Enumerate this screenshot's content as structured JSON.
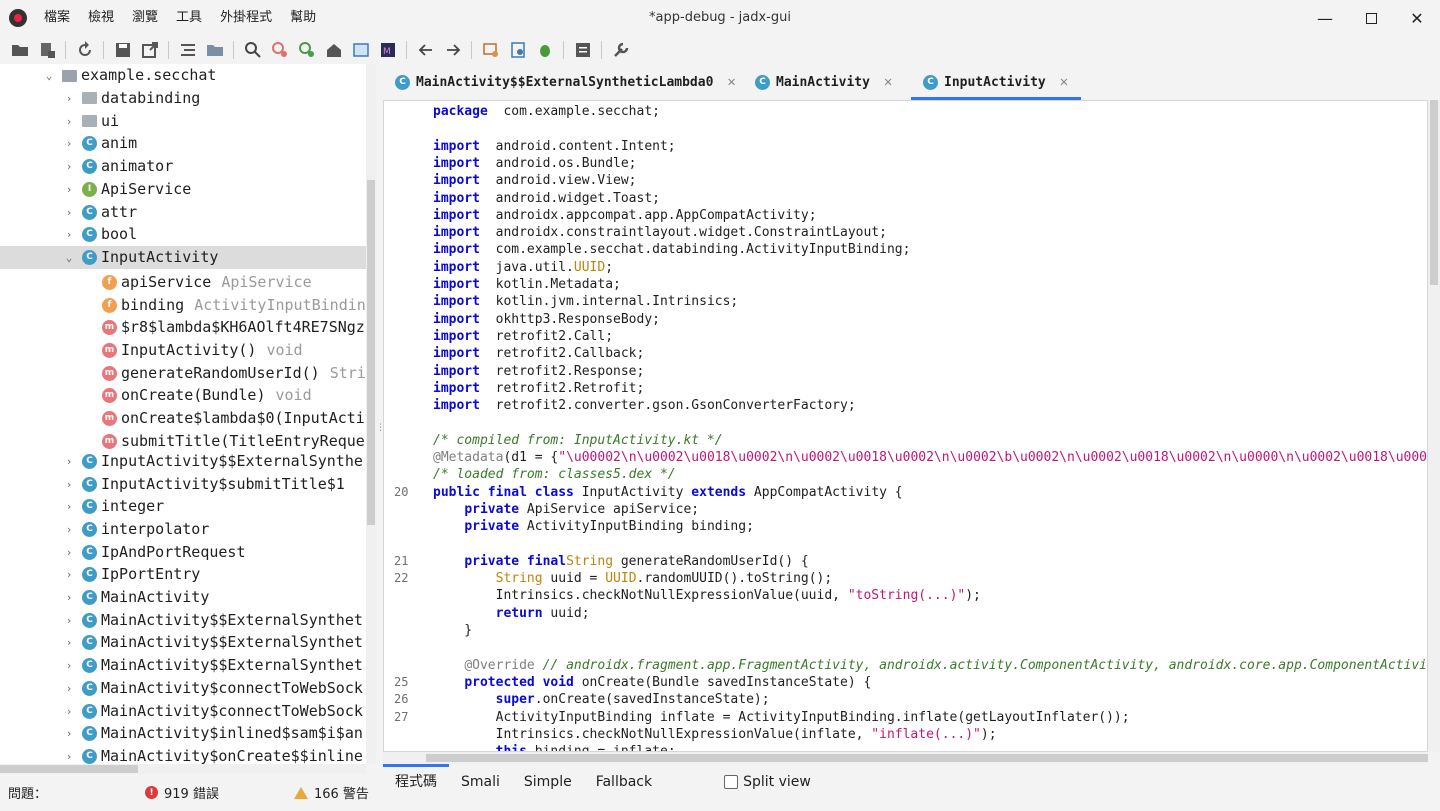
{
  "window": {
    "title": "*app-debug - jadx-gui"
  },
  "menu": [
    "檔案",
    "檢視",
    "瀏覽",
    "工具",
    "外掛程式",
    "幫助"
  ],
  "toolbar": {
    "icons": [
      "open-file-icon",
      "add-files-icon",
      "sync-icon",
      "save-all-icon",
      "export-icon",
      "sync-tree-icon",
      "flatten-packages-icon",
      "search-icon",
      "find-usages-icon",
      "search-class-icon",
      "home-icon",
      "log-viewer-icon",
      "smali-icon",
      "back-icon",
      "forward-icon",
      "quark-icon",
      "deobfuscation-icon",
      "debug-icon",
      "settings-list-icon",
      "preferences-icon"
    ]
  },
  "tree": {
    "items": [
      {
        "label": "example.secchat",
        "hint": "",
        "icon": "package",
        "chevron": "down",
        "indent": 0
      },
      {
        "label": "databinding",
        "hint": "",
        "icon": "folder",
        "chevron": "right",
        "indent": 1
      },
      {
        "label": "ui",
        "hint": "",
        "icon": "folder",
        "chevron": "right",
        "indent": 1
      },
      {
        "label": "anim",
        "hint": "",
        "icon": "class",
        "chevron": "right",
        "indent": 1
      },
      {
        "label": "animator",
        "hint": "",
        "icon": "class",
        "chevron": "right",
        "indent": 1
      },
      {
        "label": "ApiService",
        "hint": "",
        "icon": "interface",
        "chevron": "right",
        "indent": 1
      },
      {
        "label": "attr",
        "hint": "",
        "icon": "class",
        "chevron": "right",
        "indent": 1
      },
      {
        "label": "bool",
        "hint": "",
        "icon": "class",
        "chevron": "right",
        "indent": 1
      },
      {
        "label": "InputActivity",
        "hint": "",
        "icon": "class",
        "chevron": "down",
        "indent": 1,
        "selected": true
      },
      {
        "label": "apiService",
        "hint": "ApiService",
        "icon": "field",
        "chevron": "",
        "indent": 2
      },
      {
        "label": "binding",
        "hint": "ActivityInputBinding",
        "icon": "field",
        "chevron": "",
        "indent": 2
      },
      {
        "label": "$r8$lambda$KH6AOlft4RE7SNgz",
        "hint": "",
        "icon": "method",
        "chevron": "",
        "indent": 2
      },
      {
        "label": "InputActivity()",
        "hint": "void",
        "icon": "method",
        "chevron": "",
        "indent": 2
      },
      {
        "label": "generateRandomUserId()",
        "hint": "String",
        "icon": "method",
        "chevron": "",
        "indent": 2
      },
      {
        "label": "onCreate(Bundle)",
        "hint": "void",
        "icon": "method",
        "chevron": "",
        "indent": 2
      },
      {
        "label": "onCreate$lambda$0(InputActivity",
        "hint": "",
        "icon": "method",
        "chevron": "",
        "indent": 2
      },
      {
        "label": "submitTitle(TitleEntryReque",
        "hint": "",
        "icon": "method",
        "chevron": "",
        "indent": 2
      },
      {
        "label": "InputActivity$$ExternalSynthe",
        "hint": "",
        "icon": "class",
        "chevron": "right",
        "indent": 1
      },
      {
        "label": "InputActivity$submitTitle$1",
        "hint": "",
        "icon": "class",
        "chevron": "right",
        "indent": 1
      },
      {
        "label": "integer",
        "hint": "",
        "icon": "class",
        "chevron": "right",
        "indent": 1
      },
      {
        "label": "interpolator",
        "hint": "",
        "icon": "class",
        "chevron": "right",
        "indent": 1
      },
      {
        "label": "IpAndPortRequest",
        "hint": "",
        "icon": "class",
        "chevron": "right",
        "indent": 1
      },
      {
        "label": "IpPortEntry",
        "hint": "",
        "icon": "class",
        "chevron": "right",
        "indent": 1
      },
      {
        "label": "MainActivity",
        "hint": "",
        "icon": "class",
        "chevron": "right",
        "indent": 1
      },
      {
        "label": "MainActivity$$ExternalSynthet",
        "hint": "",
        "icon": "class",
        "chevron": "right",
        "indent": 1
      },
      {
        "label": "MainActivity$$ExternalSynthet",
        "hint": "",
        "icon": "class",
        "chevron": "right",
        "indent": 1
      },
      {
        "label": "MainActivity$$ExternalSynthet",
        "hint": "",
        "icon": "class",
        "chevron": "right",
        "indent": 1
      },
      {
        "label": "MainActivity$connectToWebSock",
        "hint": "",
        "icon": "class",
        "chevron": "right",
        "indent": 1
      },
      {
        "label": "MainActivity$connectToWebSock",
        "hint": "",
        "icon": "class",
        "chevron": "right",
        "indent": 1
      },
      {
        "label": "MainActivity$inlined$sam$i$an",
        "hint": "",
        "icon": "class",
        "chevron": "right",
        "indent": 1
      },
      {
        "label": "MainActivity$onCreate$$inline",
        "hint": "",
        "icon": "class",
        "chevron": "right",
        "indent": 1
      }
    ]
  },
  "tabs": [
    {
      "label": "MainActivity$$ExternalSyntheticLambda0",
      "active": false
    },
    {
      "label": "MainActivity",
      "active": false
    },
    {
      "label": "InputActivity",
      "active": true
    }
  ],
  "code": [
    {
      "ln": "",
      "parts": [
        [
          "kw",
          "package"
        ],
        [
          "",
          "  com.example.secchat;"
        ]
      ]
    },
    {
      "ln": "",
      "parts": []
    },
    {
      "ln": "",
      "parts": [
        [
          "kw",
          "import"
        ],
        [
          "",
          "  android.content.Intent;"
        ]
      ]
    },
    {
      "ln": "",
      "parts": [
        [
          "kw",
          "import"
        ],
        [
          "",
          "  android.os.Bundle;"
        ]
      ]
    },
    {
      "ln": "",
      "parts": [
        [
          "kw",
          "import"
        ],
        [
          "",
          "  android.view.View;"
        ]
      ]
    },
    {
      "ln": "",
      "parts": [
        [
          "kw",
          "import"
        ],
        [
          "",
          "  android.widget.Toast;"
        ]
      ]
    },
    {
      "ln": "",
      "parts": [
        [
          "kw",
          "import"
        ],
        [
          "",
          "  androidx.appcompat.app.AppCompatActivity;"
        ]
      ]
    },
    {
      "ln": "",
      "parts": [
        [
          "kw",
          "import"
        ],
        [
          "",
          "  androidx.constraintlayout.widget.ConstraintLayout;"
        ]
      ]
    },
    {
      "ln": "",
      "parts": [
        [
          "kw",
          "import"
        ],
        [
          "",
          "  com.example.secchat.databinding.ActivityInputBinding;"
        ]
      ]
    },
    {
      "ln": "",
      "parts": [
        [
          "kw",
          "import"
        ],
        [
          "",
          "  java.util."
        ],
        [
          "ty",
          "UUID"
        ],
        [
          "",
          ";"
        ]
      ]
    },
    {
      "ln": "",
      "parts": [
        [
          "kw",
          "import"
        ],
        [
          "",
          "  kotlin.Metadata;"
        ]
      ]
    },
    {
      "ln": "",
      "parts": [
        [
          "kw",
          "import"
        ],
        [
          "",
          "  kotlin.jvm.internal.Intrinsics;"
        ]
      ]
    },
    {
      "ln": "",
      "parts": [
        [
          "kw",
          "import"
        ],
        [
          "",
          "  okhttp3.ResponseBody;"
        ]
      ]
    },
    {
      "ln": "",
      "parts": [
        [
          "kw",
          "import"
        ],
        [
          "",
          "  retrofit2.Call;"
        ]
      ]
    },
    {
      "ln": "",
      "parts": [
        [
          "kw",
          "import"
        ],
        [
          "",
          "  retrofit2.Callback;"
        ]
      ]
    },
    {
      "ln": "",
      "parts": [
        [
          "kw",
          "import"
        ],
        [
          "",
          "  retrofit2.Response;"
        ]
      ]
    },
    {
      "ln": "",
      "parts": [
        [
          "kw",
          "import"
        ],
        [
          "",
          "  retrofit2.Retrofit;"
        ]
      ]
    },
    {
      "ln": "",
      "parts": [
        [
          "kw",
          "import"
        ],
        [
          "",
          "  retrofit2.converter.gson.GsonConverterFactory;"
        ]
      ]
    },
    {
      "ln": "",
      "parts": []
    },
    {
      "ln": "",
      "parts": [
        [
          "cm",
          "/* compiled from: InputActivity.kt */"
        ]
      ]
    },
    {
      "ln": "",
      "parts": [
        [
          "an",
          "@Metadata"
        ],
        [
          "",
          "(d1 = {"
        ],
        [
          "st",
          "\"\\u00002\\n\\u0002\\u0018\\u0002\\n\\u0002\\u0018\\u0002\\n\\u0002\\b\\u0002\\n\\u0002\\u0018\\u0002\\n\\u0000\\n\\u0002\\u0018\\u0002\\n\\u"
        ]
      ]
    },
    {
      "ln": "",
      "parts": [
        [
          "cm",
          "/* loaded from: classes5.dex */"
        ]
      ]
    },
    {
      "ln": "20",
      "parts": [
        [
          "kw",
          "public final class"
        ],
        [
          "",
          " InputActivity "
        ],
        [
          "kw",
          "extends"
        ],
        [
          "",
          " AppCompatActivity {"
        ]
      ]
    },
    {
      "ln": "",
      "parts": [
        [
          "",
          "    "
        ],
        [
          "kw",
          "private"
        ],
        [
          "",
          " ApiService apiService;"
        ]
      ]
    },
    {
      "ln": "",
      "parts": [
        [
          "",
          "    "
        ],
        [
          "kw",
          "private"
        ],
        [
          "",
          " ActivityInputBinding binding;"
        ]
      ]
    },
    {
      "ln": "",
      "parts": []
    },
    {
      "ln": "21",
      "parts": [
        [
          "",
          "    "
        ],
        [
          "kw",
          "private final"
        ],
        [
          " ",
          ""
        ],
        [
          "ty",
          "String"
        ],
        [
          "",
          " generateRandomUserId() {"
        ]
      ]
    },
    {
      "ln": "22",
      "parts": [
        [
          "",
          "        "
        ],
        [
          "ty",
          "String"
        ],
        [
          "",
          " uuid = "
        ],
        [
          "ty",
          "UUID"
        ],
        [
          "",
          ".randomUUID().toString();"
        ]
      ]
    },
    {
      "ln": "",
      "parts": [
        [
          "",
          "        Intrinsics.checkNotNullExpressionValue(uuid, "
        ],
        [
          "st",
          "\"toString(...)\""
        ],
        [
          "",
          ");"
        ]
      ]
    },
    {
      "ln": "",
      "parts": [
        [
          "",
          "        "
        ],
        [
          "kw",
          "return"
        ],
        [
          "",
          " uuid;"
        ]
      ]
    },
    {
      "ln": "",
      "parts": [
        [
          "",
          "    }"
        ]
      ]
    },
    {
      "ln": "",
      "parts": []
    },
    {
      "ln": "",
      "parts": [
        [
          "",
          "    "
        ],
        [
          "an",
          "@Override"
        ],
        [
          "",
          " "
        ],
        [
          "cm",
          "// androidx.fragment.app.FragmentActivity, androidx.activity.ComponentActivity, androidx.core.app.ComponentActivity, a"
        ]
      ]
    },
    {
      "ln": "25",
      "parts": [
        [
          "",
          "    "
        ],
        [
          "kw",
          "protected void"
        ],
        [
          "",
          " onCreate(Bundle savedInstanceState) {"
        ]
      ]
    },
    {
      "ln": "26",
      "parts": [
        [
          "",
          "        "
        ],
        [
          "kw",
          "super"
        ],
        [
          "",
          ".onCreate(savedInstanceState);"
        ]
      ]
    },
    {
      "ln": "27",
      "parts": [
        [
          "",
          "        ActivityInputBinding inflate = ActivityInputBinding.inflate(getLayoutInflater());"
        ]
      ]
    },
    {
      "ln": "",
      "parts": [
        [
          "",
          "        Intrinsics.checkNotNullExpressionValue(inflate, "
        ],
        [
          "st",
          "\"inflate(...)\""
        ],
        [
          "",
          ");"
        ]
      ]
    },
    {
      "ln": "",
      "parts": [
        [
          "",
          "        "
        ],
        [
          "kw",
          "this"
        ],
        [
          "",
          ".binding = inflate;"
        ]
      ]
    }
  ],
  "bottom_tabs": [
    {
      "label": "程式碼",
      "active": true
    },
    {
      "label": "Smali",
      "active": false
    },
    {
      "label": "Simple",
      "active": false
    },
    {
      "label": "Fallback",
      "active": false
    }
  ],
  "split_view": {
    "label": "Split view",
    "checked": false
  },
  "status": {
    "problems_label": "問題：",
    "errors": "919 錯誤",
    "warnings": "166 警告"
  }
}
